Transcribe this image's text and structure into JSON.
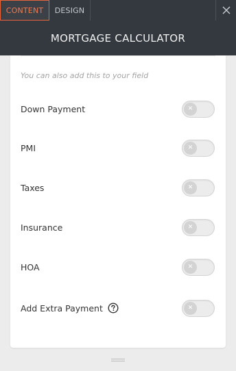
{
  "tabs": [
    {
      "label": "CONTENT",
      "active": true
    },
    {
      "label": "DESIGN",
      "active": false
    }
  ],
  "header": {
    "title": "MORTGAGE CALCULATOR"
  },
  "panel": {
    "hint": "You can also add this to your field",
    "options": [
      {
        "label": "Down Payment",
        "enabled": false
      },
      {
        "label": "PMI",
        "enabled": false
      },
      {
        "label": "Taxes",
        "enabled": false
      },
      {
        "label": "Insurance",
        "enabled": false
      },
      {
        "label": "HOA",
        "enabled": false
      },
      {
        "label": "Add Extra Payment",
        "enabled": false,
        "has_help": true
      }
    ]
  },
  "icons": {
    "close": "close-icon",
    "help": "question-circle-icon",
    "toggle_off": "x-icon",
    "resize": "drag-handle-icon"
  },
  "colors": {
    "active_tab": "#e8643a",
    "header_bg": "#33393f",
    "toggle_off": "#d3d3d3"
  }
}
